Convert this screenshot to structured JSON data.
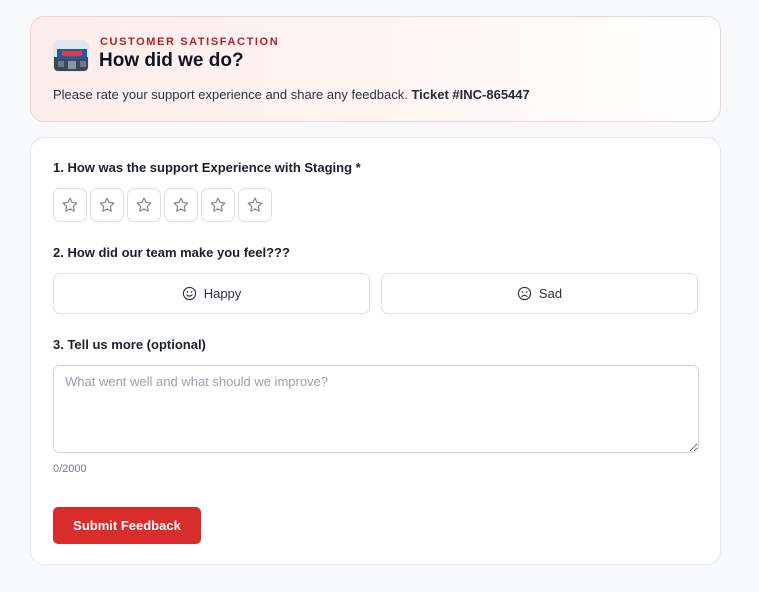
{
  "header": {
    "kicker": "CUSTOMER SATISFACTION",
    "title": "How did we do?",
    "subtitle": "Please rate your support experience and share any feedback.",
    "ticket": "Ticket #INC-865447"
  },
  "questions": {
    "q1_label": "1. How was the support Experience with Staging *",
    "q1_rating": {
      "max": 6,
      "selected": 0
    },
    "q2_label": "2. How did our team make you feel???",
    "q2_options": [
      {
        "label": "Happy",
        "icon": "smile-icon"
      },
      {
        "label": "Sad",
        "icon": "frown-icon"
      }
    ],
    "q3_label": "3. Tell us more (optional)",
    "q3_placeholder": "What went well and what should we improve?",
    "q3_value": "",
    "q3_counter": "0/2000"
  },
  "submit_label": "Submit Feedback",
  "colors": {
    "accent": "#d92c2c",
    "kicker": "#b42323",
    "star_outline": "#7a808c"
  }
}
